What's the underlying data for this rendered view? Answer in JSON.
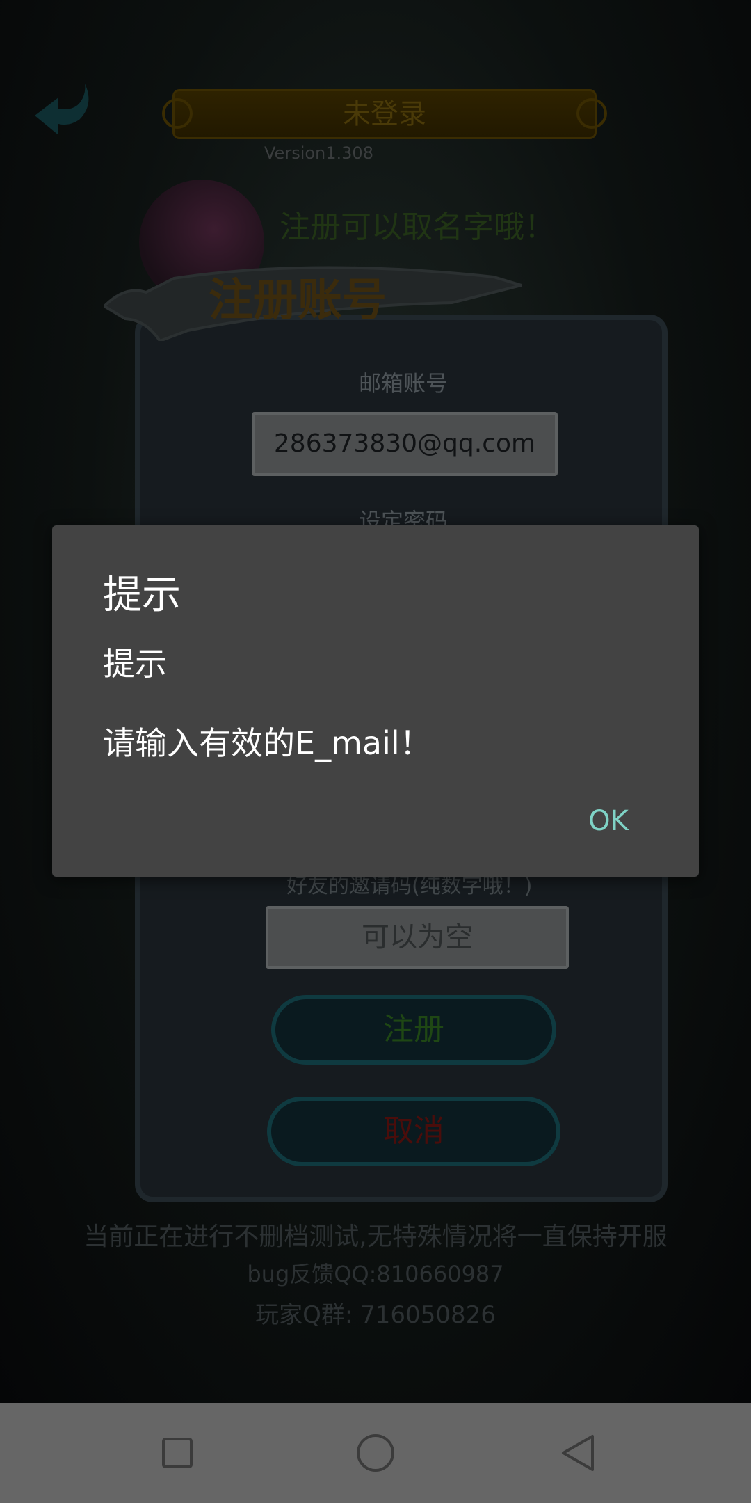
{
  "game": {
    "header": {
      "title": "未登录",
      "version": "Version1.308",
      "tagline": "注册可以取名字哦！"
    },
    "register_panel": {
      "title": "注册账号",
      "email_label": "邮箱账号",
      "email_value": "286373830@qq.com",
      "password_label": "设定密码",
      "invite_label": "好友的邀请码(纯数字哦！)",
      "invite_placeholder": "可以为空",
      "register_button": "注册",
      "cancel_button": "取消"
    },
    "notice": {
      "line1": "当前正在进行不删档测试,无特殊情况将一直保持开服",
      "line2": "bug反馈QQ:810660987",
      "line3": "玩家Q群: 716050826"
    }
  },
  "dialog": {
    "title": "提示",
    "subtitle": "提示",
    "message": "请输入有效的E_mail！",
    "ok_label": "OK"
  },
  "navbar": {
    "icons": [
      "recents-icon",
      "home-icon",
      "back-icon"
    ]
  },
  "colors": {
    "dialog_bg": "#434343",
    "ok_accent": "#7fd3c6",
    "navbar_bg": "#666666"
  }
}
